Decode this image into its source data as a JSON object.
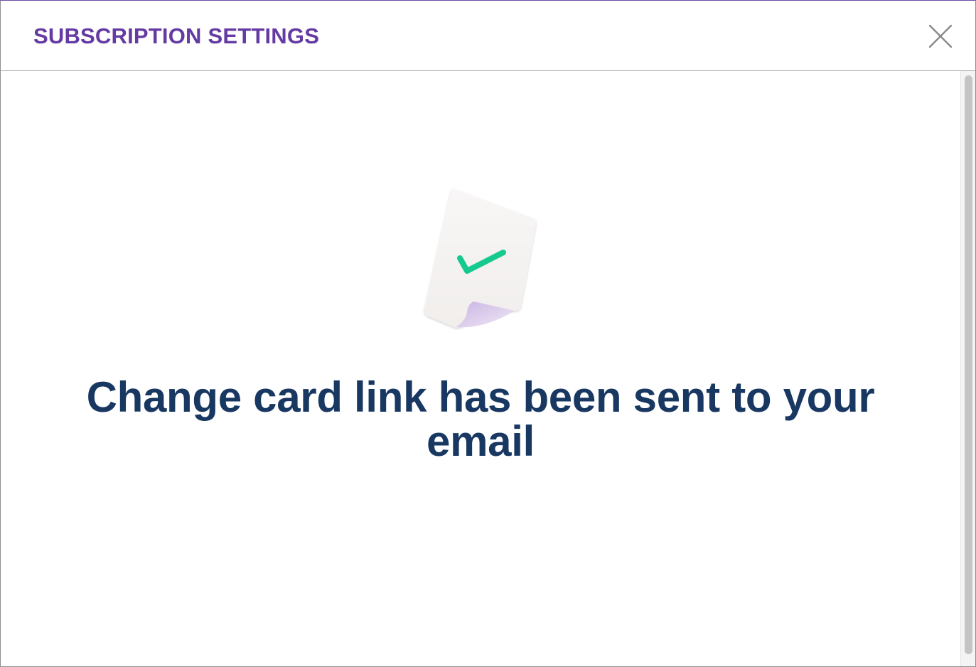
{
  "dialog": {
    "title": "SUBSCRIPTION SETTINGS",
    "close_icon": "close-icon"
  },
  "content": {
    "illustration_icon": "document-checkmark-icon",
    "message": "Change card link has been sent to your email"
  },
  "colors": {
    "title": "#643AA3",
    "message": "#183862",
    "check": "#15C98F",
    "close_icon": "#8A8A8A",
    "paper": "#F6F4F2",
    "paper_curl": "#D9C8EA"
  }
}
